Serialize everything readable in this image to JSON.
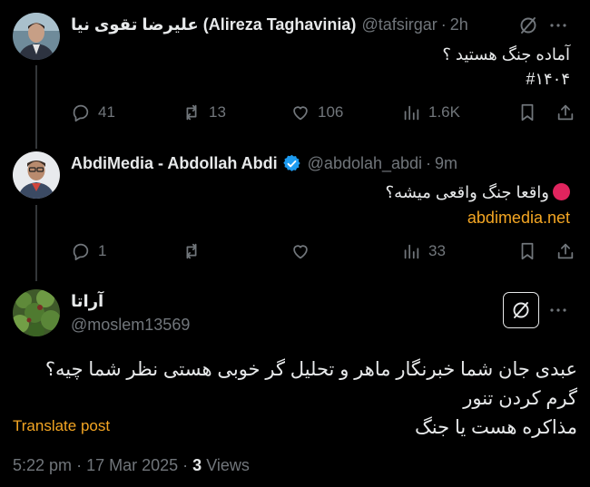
{
  "tweets": [
    {
      "name_fa": "علیرضا تقوی نیا",
      "name_en": "(Alireza Taghavinia)",
      "handle": "@tafsirgar",
      "time": "2h",
      "text_line1": "آماده جنگ هستید ؟",
      "text_line2": "#۱۴۰۴",
      "replies": "41",
      "reposts": "13",
      "likes": "106",
      "views": "1.6K"
    },
    {
      "name": "AbdiMedia - Abdollah Abdi",
      "handle": "@abdolah_abdi",
      "time": "9m",
      "text_line1": "واقعا جنگ واقعی میشه؟",
      "link": "abdimedia.net",
      "replies": "1",
      "reposts": "",
      "likes": "",
      "views": "33"
    }
  ],
  "main_tweet": {
    "name": "آراتا",
    "handle": "@moslem13569",
    "text_line1": "عبدی جان شما خبرنگار ماهر و تحلیل گر خوبی هستی نظر شما چیه؟ گرم کردن تنور",
    "text_line2": "مذاکره هست یا جنگ",
    "translate": "Translate post",
    "time": "5:22 pm",
    "date": "17 Mar 2025",
    "views_count": "3",
    "views_label": "Views"
  },
  "colors": {
    "background": "#000000",
    "text": "#e7e9ea",
    "muted": "#71767b",
    "link": "#f4a623",
    "verified": "#1d9bf0",
    "red_dot": "#e0245e"
  }
}
